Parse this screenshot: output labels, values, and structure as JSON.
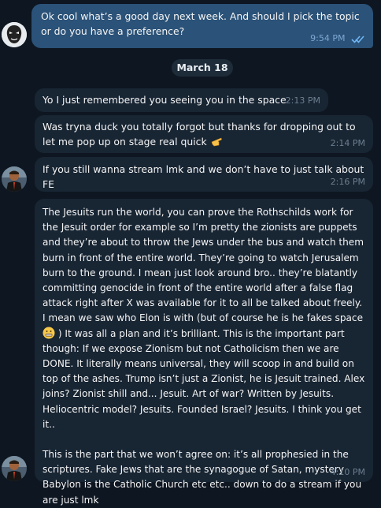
{
  "messages": [
    {
      "id": "m1",
      "direction": "out",
      "text": "Ok cool what’s a good day next week. And should I pick the topic or do you have a preference?",
      "time": "9:54 PM",
      "status": "read"
    },
    {
      "id": "m2",
      "direction": "in",
      "text": "Yo I just remembered you seeing you in the space",
      "time": "2:13 PM"
    },
    {
      "id": "m3",
      "direction": "in",
      "text": "Was tryna duck you totally forgot but thanks for dropping out to let me pop up on stage real quick",
      "time": "2:14 PM",
      "emoji": "pointing-hand-emoji"
    },
    {
      "id": "m4",
      "direction": "in",
      "text": "If you still wanna stream lmk and we don’t have to just talk about FE",
      "time": "2:16 PM"
    },
    {
      "id": "m5",
      "direction": "in",
      "text_part1": "The Jesuits run the world, you can prove the Rothschilds work for the Jesuit order for example so I’m pretty the zionists are puppets and they’re about to throw the Jews under the bus and watch them burn in front of the entire world. They’re going to watch Jerusalem burn to the ground. I mean just look around bro.. they’re blatantly committing genocide in front of the entire world after a false flag attack right after X was available for it to all be talked about freely. I mean we saw who Elon is with (but of course he is he fakes space",
      "text_part2": ") It was all a plan and it’s brilliant. This is the important part though: If we expose Zionism but not Catholicism then we are DONE. It literally means universal, they will scoop in and build on top of the ashes. Trump isn’t just a Zionist, he is Jesuit trained. Alex joins? Zionist shill and... Jesuit. Art of war? Written by Jesuits. Heliocentric model? Jesuits. Founded Israel? Jesuits. I think you get it..",
      "text_part3": "This is the part that we won’t agree on: it’s all prophesied in the scriptures. Fake Jews that are the synagogue of Satan, mystery Babylon is the Catholic Church etc etc.. down to do a stream if you are just lmk",
      "time": "4:10 PM",
      "emoji": "grimacing-face-emoji"
    }
  ],
  "date_separator": "March 18",
  "colors": {
    "background": "#0e1621",
    "incoming_bubble": "#182533",
    "outgoing_bubble": "#2b5278",
    "timestamp": "#6d7f8f",
    "read_ticks": "#6eb6f5"
  }
}
